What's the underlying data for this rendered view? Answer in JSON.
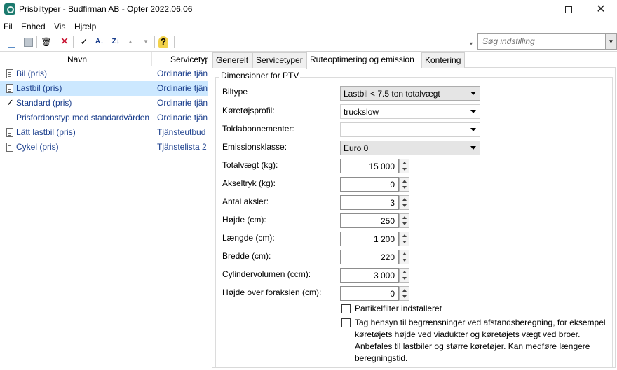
{
  "window": {
    "title": "Prisbiltyper - Budfirman AB - Opter 2022.06.06",
    "minimize": "–",
    "close": "✕"
  },
  "menu": [
    "Fil",
    "Enhed",
    "Vis",
    "Hjælp"
  ],
  "toolbar": {
    "icons": [
      "new-document-icon",
      "save-icon",
      "delete-icon",
      "cancel-icon",
      "check-icon",
      "sort-az-icon",
      "sort-za-icon",
      "move-up-icon",
      "move-down-icon",
      "help-icon"
    ],
    "check_glyph": "✓",
    "cancel_glyph": "✕",
    "help_glyph": "?",
    "sort_az": "A↓",
    "sort_za": "Z↓",
    "up_glyph": "▲",
    "down_glyph": "▼",
    "delete_glyph": "🗑"
  },
  "search": {
    "placeholder": "Søg indstilling",
    "dropdown_glyph": "▼",
    "marker": "▾"
  },
  "list": {
    "columns": [
      "Navn",
      "Servicetyp"
    ],
    "rows": [
      {
        "icon": "document",
        "name": "Bil (pris)",
        "type": "Ordinarie tjänster",
        "selected": false
      },
      {
        "icon": "document",
        "name": "Lastbil (pris)",
        "type": "Ordinarie tjänster",
        "selected": true
      },
      {
        "icon": "check",
        "name": "Standard (pris)",
        "type": "Ordinarie tjänster",
        "selected": false
      },
      {
        "icon": "none",
        "name": "Prisfordonstyp med standardvärden",
        "type": "Ordinarie tjänster",
        "selected": false
      },
      {
        "icon": "document",
        "name": "Lätt lastbil (pris)",
        "type": "Tjänsteutbud",
        "selected": false
      },
      {
        "icon": "document",
        "name": "Cykel (pris)",
        "type": "Tjänstelista 2",
        "selected": false
      }
    ],
    "check_glyph": "✓"
  },
  "tabs": [
    "Generelt",
    "Servicetyper",
    "Ruteoptimering og emission",
    "Kontering"
  ],
  "active_tab": 2,
  "group_title": "Dimensioner for PTV",
  "fields": {
    "biltype": {
      "label": "Biltype",
      "value": "Lastbil < 7.5 ton totalvægt"
    },
    "profil": {
      "label": "Køretøjsprofil:",
      "value": "truckslow"
    },
    "told": {
      "label": "Toldabonnementer:",
      "value": ""
    },
    "emission": {
      "label": "Emissionsklasse:",
      "value": "Euro 0"
    },
    "totalvaegt": {
      "label": "Totalvægt (kg):",
      "value": "15 000"
    },
    "akseltryk": {
      "label": "Akseltryk (kg):",
      "value": "0"
    },
    "aksler": {
      "label": "Antal aksler:",
      "value": "3"
    },
    "hojde": {
      "label": "Højde (cm):",
      "value": "250"
    },
    "laengde": {
      "label": "Længde (cm):",
      "value": "1 200"
    },
    "bredde": {
      "label": "Bredde (cm):",
      "value": "220"
    },
    "cylinder": {
      "label": "Cylindervolumen (ccm):",
      "value": "3 000"
    },
    "hojde_aksel": {
      "label": "Højde over forakslen (cm):",
      "value": "0"
    }
  },
  "checkboxes": {
    "partikel": {
      "label": "Partikelfilter indstalleret",
      "checked": false
    },
    "begraensning": {
      "label": "Tag hensyn til begrænsninger ved afstandsberegning, for eksempel køretøjets højde ved viadukter og køretøjets vægt ved broer. Anbefales til lastbiler og større køretøjer. Kan medføre længere beregningstid.",
      "checked": false
    }
  }
}
